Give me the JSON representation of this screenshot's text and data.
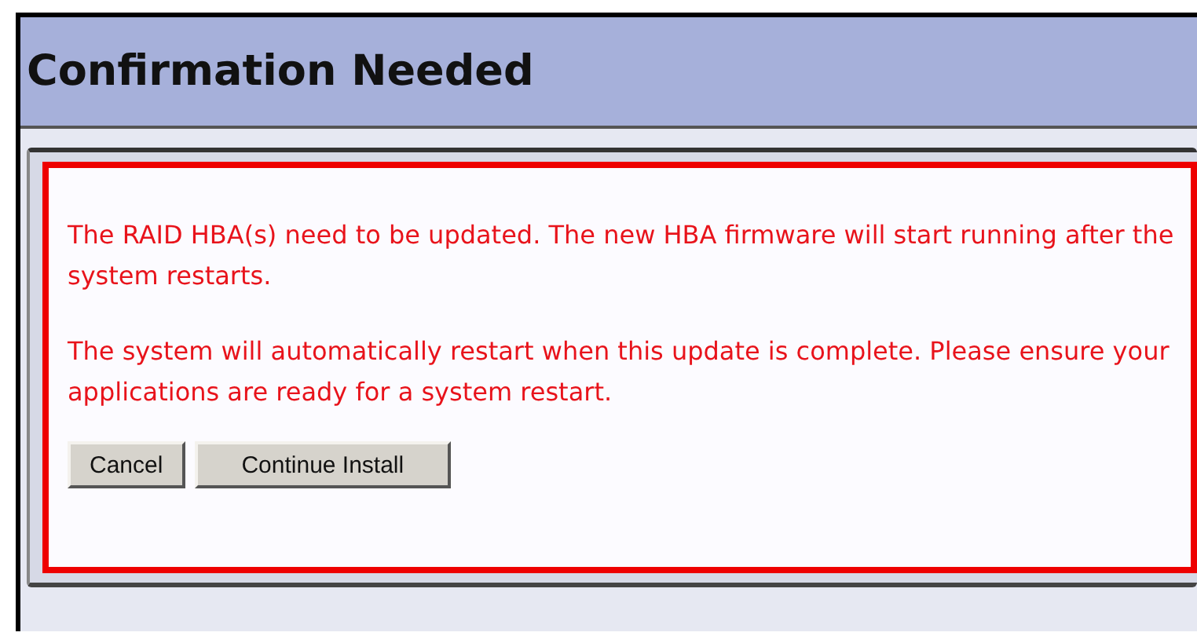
{
  "window": {
    "title": "Confirmation Needed"
  },
  "message": {
    "paragraphs": [
      "The RAID HBA(s) need to be updated. The new HBA firmware will start running after the system restarts.",
      "The system will automatically restart when this update is complete. Please ensure your applications are ready for a system restart."
    ]
  },
  "buttons": [
    {
      "label": "Cancel",
      "kind": "cancel"
    },
    {
      "label": "Continue Install",
      "kind": "confirm"
    }
  ]
}
